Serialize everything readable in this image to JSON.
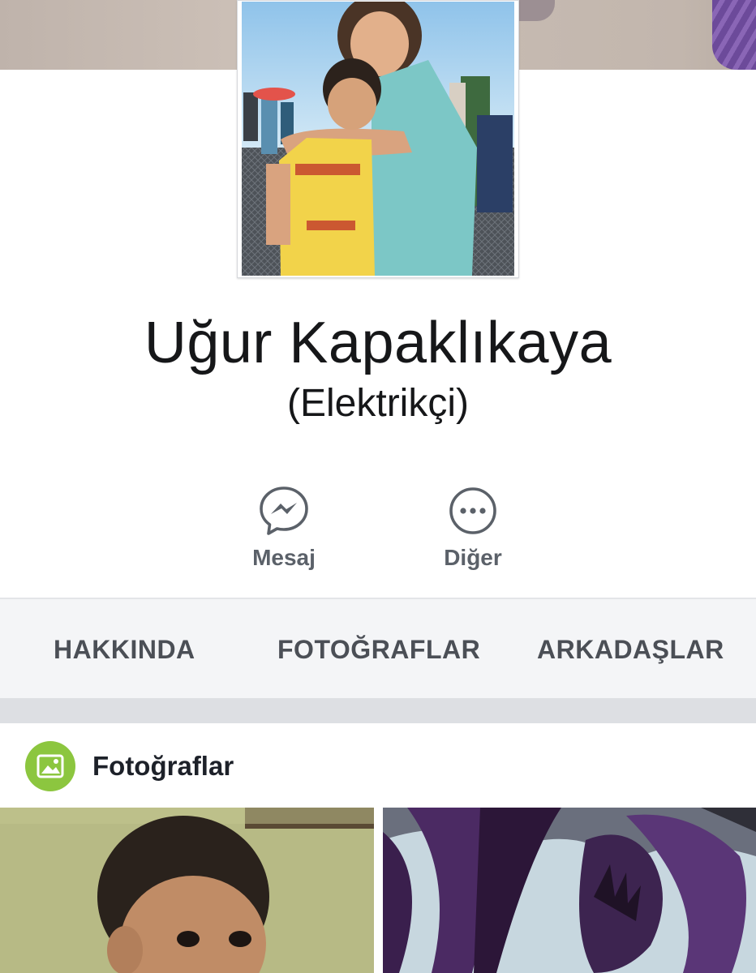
{
  "profile": {
    "name": "Uğur Kapaklıkaya",
    "subtitle": "(Elektrikçi)"
  },
  "actions": {
    "message_label": "Mesaj",
    "more_label": "Diğer"
  },
  "tabs": [
    {
      "label": "HAKKINDA"
    },
    {
      "label": "FOTOĞRAFLAR"
    },
    {
      "label": "ARKADAŞLAR"
    }
  ],
  "photos_section": {
    "title": "Fotoğraflar"
  },
  "colors": {
    "photos_badge": "#8cc63f",
    "tab_text": "#4b4f56",
    "action_text": "#5b6169",
    "tabs_background": "#f4f5f7"
  },
  "icons": {
    "message": "messenger-icon",
    "more": "more-options-icon",
    "photos": "photo-icon"
  }
}
